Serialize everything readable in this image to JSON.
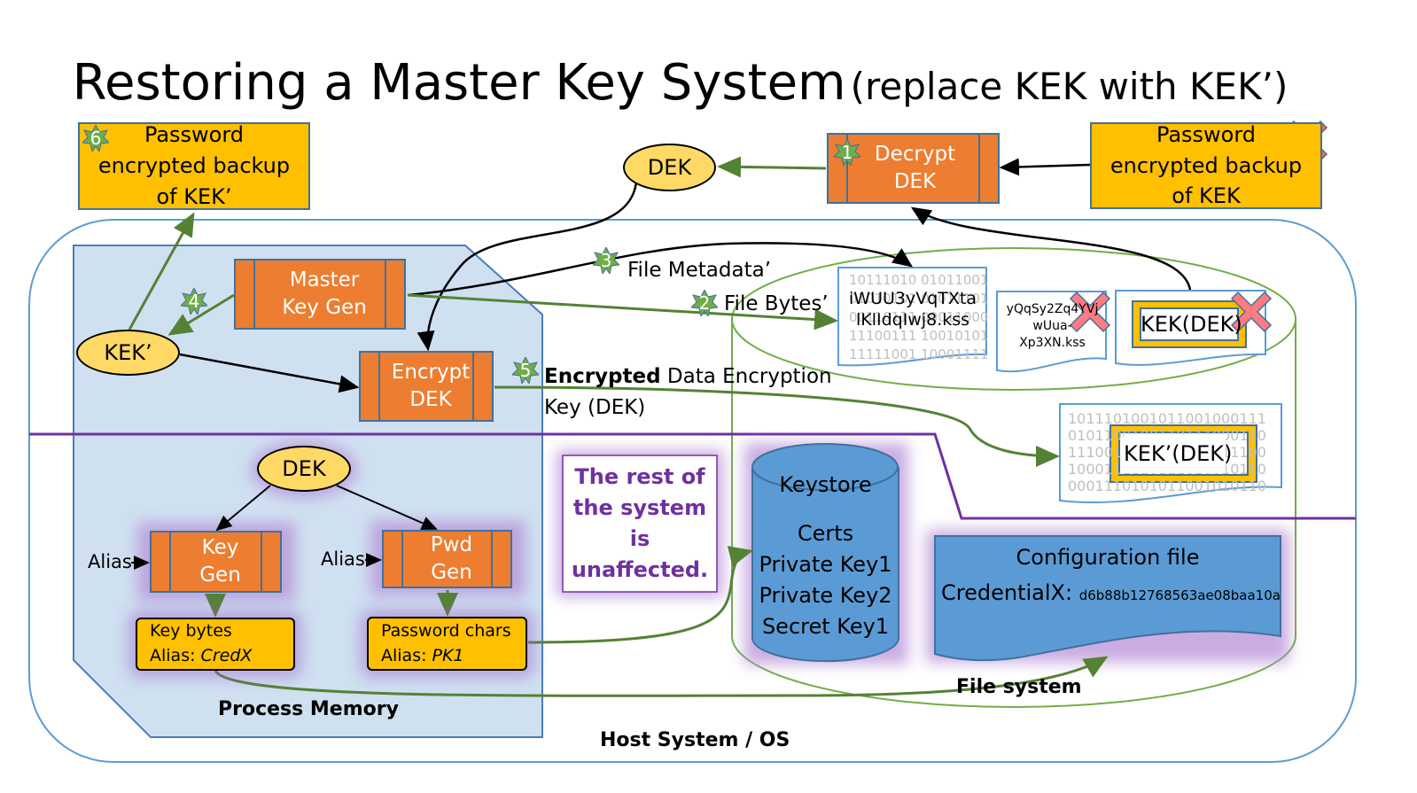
{
  "title": {
    "main": "Restoring a Master Key System",
    "sub": "(replace KEK with KEK’)"
  },
  "boxes": {
    "backup_new": "Password encrypted backup of KEK’",
    "backup_old": "Password encrypted backup of KEK",
    "decrypt_dek": "Decrypt DEK",
    "master_key_gen": "Master Key Gen",
    "encrypt_dek": "Encrypt DEK",
    "key_gen": "Key Gen",
    "pwd_gen": "Pwd Gen",
    "key_bytes": "Key bytes",
    "key_alias_label": "Alias: ",
    "key_alias": "CredX",
    "pwd_chars": "Password chars",
    "pwd_alias_label": "Alias: ",
    "pwd_alias": "PK1",
    "rest": "The rest of the system is unaffected."
  },
  "ellipses": {
    "dek_top": "DEK",
    "kek_new": "KEK’",
    "dek_mem": "DEK"
  },
  "badges": [
    "1",
    "2",
    "3",
    "4",
    "5",
    "6"
  ],
  "labels": {
    "file_metadata": "File Metadata’",
    "file_bytes": "File Bytes’",
    "encrypted_bold": "Encrypted",
    "encrypted_rest": " Data Encryption",
    "encrypted_line2": "Key (DEK)",
    "alias1": "Alias",
    "alias2": "Alias",
    "process_memory": "Process Memory",
    "host_system": "Host System / OS",
    "file_system": "File system"
  },
  "files": {
    "file1_name": "iWUU3yVqTXta lKlIdqIwj8.kss",
    "file1_bits": [
      "10111010 01011001",
      "01010101 01011101",
      "00110111 00011000",
      "11100111 10010101",
      "11111001 10001111"
    ],
    "file2_name": "yQqSy2Zq4YVj wUua-Xp3XN.kss",
    "file3_name": "KEK(DEK)",
    "file4_name": "KEK’(DEK)",
    "file4_bits": [
      "1011101001011001000111",
      "0101100100110111000110",
      "1110011110010101111100",
      "1000111110111010010110",
      "0001110101011001010110"
    ]
  },
  "keystore": {
    "title": "Keystore",
    "items": [
      "Certs",
      "Private Key1",
      "Private Key2",
      "Secret Key1"
    ]
  },
  "config": {
    "title": "Configuration file",
    "key": "CredentialX:",
    "value": "d6b88b12768563ae08baa10a"
  },
  "colors": {
    "orange": "#ed7d31",
    "yellow": "#ffc000",
    "blue": "#5b9bd5",
    "green": "#70ad47",
    "purple": "#7030a0",
    "memory": "#cfe0f1",
    "cross": "#ff7c80"
  }
}
